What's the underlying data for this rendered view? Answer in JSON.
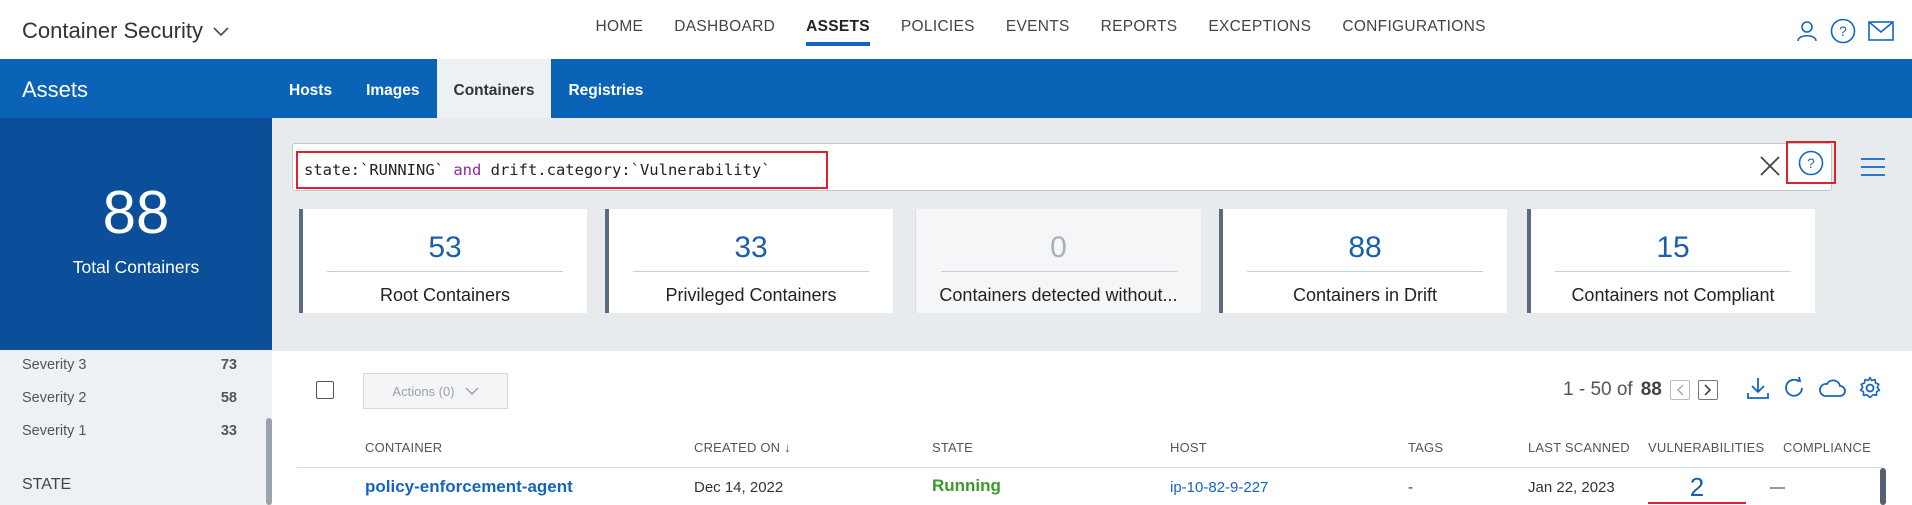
{
  "app": {
    "title": "Container Security"
  },
  "nav": [
    "HOME",
    "DASHBOARD",
    "ASSETS",
    "POLICIES",
    "EVENTS",
    "REPORTS",
    "EXCEPTIONS",
    "CONFIGURATIONS"
  ],
  "nav_active": "ASSETS",
  "section": {
    "title": "Assets"
  },
  "subtabs": [
    "Hosts",
    "Images",
    "Containers",
    "Registries"
  ],
  "subtab_active": "Containers",
  "summary": {
    "total": "88",
    "total_label": "Total Containers"
  },
  "sidebar": {
    "severities": [
      {
        "label": "Severity 3",
        "count": "73"
      },
      {
        "label": "Severity 2",
        "count": "58"
      },
      {
        "label": "Severity 1",
        "count": "33"
      }
    ],
    "state_heading": "STATE"
  },
  "search": {
    "q1": "state:`RUNNING` ",
    "q2": "and",
    "q3": " drift.category:`Vulnerability`"
  },
  "cards": [
    {
      "value": "53",
      "label": "Root Containers"
    },
    {
      "value": "33",
      "label": "Privileged Containers"
    },
    {
      "value": "0",
      "label": "Containers detected without..."
    },
    {
      "value": "88",
      "label": "Containers in Drift"
    },
    {
      "value": "15",
      "label": "Containers not Compliant"
    }
  ],
  "toolbar": {
    "actions_label": "Actions (0)"
  },
  "pager": {
    "range": "1 - 50 of",
    "total": "88"
  },
  "table": {
    "headers": [
      "CONTAINER",
      "CREATED ON",
      "STATE",
      "HOST",
      "TAGS",
      "LAST SCANNED",
      "VULNERABILITIES",
      "COMPLIANCE"
    ],
    "sort_indicator": "↓",
    "rows": [
      {
        "container": "policy-enforcement-agent",
        "created": "Dec 14, 2022",
        "state": "Running",
        "host": "ip-10-82-9-227",
        "tags": "-",
        "last_scanned": "Jan 22, 2023",
        "vulnerabilities": "2",
        "compliance": "—"
      }
    ]
  },
  "colors": {
    "brand_blue": "#0b63b8",
    "panel_blue": "#0b4f9a",
    "highlight_red": "#e0202a",
    "running_green": "#3a9a2c"
  }
}
